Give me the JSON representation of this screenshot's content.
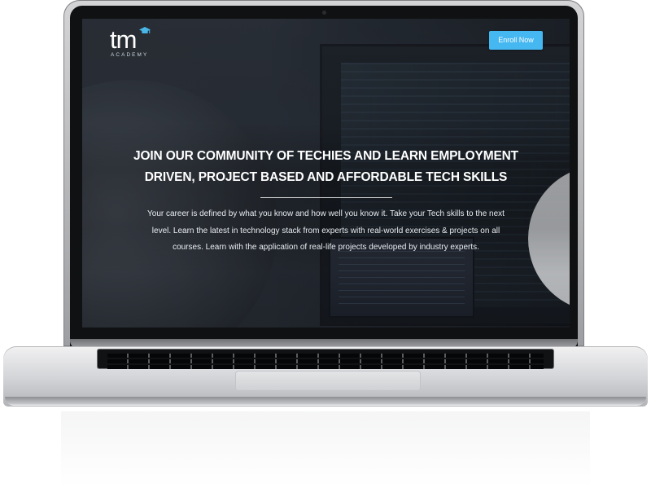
{
  "brand": {
    "logo_text": "tm",
    "logo_sub": "ACADEMY"
  },
  "header": {
    "cta_label": "Enroll Now"
  },
  "hero": {
    "title_line1": "JOIN OUR COMMUNITY OF TECHIES AND LEARN EMPLOYMENT",
    "title_line2": "DRIVEN, PROJECT BASED AND AFFORDABLE TECH SKILLS",
    "desc_line1": "Your career is defined by what you know and how well you know it. Take your Tech skills to the next",
    "desc_line2": "level. Learn the latest in technology stack from experts with real-world exercises & projects on all",
    "desc_line3": "courses. Learn with the application of real-life projects developed by industry experts."
  },
  "colors": {
    "accent": "#45b7f1",
    "hero_text": "#ffffff"
  },
  "icons": {
    "logo_cap": "graduation-cap-icon",
    "camera": "webcam-dot"
  }
}
